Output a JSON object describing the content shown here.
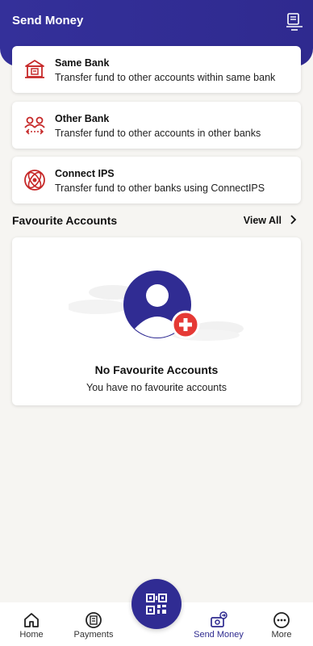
{
  "header": {
    "title": "Send Money"
  },
  "options": [
    {
      "title": "Same Bank",
      "desc": "Transfer fund to other accounts within same bank"
    },
    {
      "title": "Other Bank",
      "desc": "Transfer fund to other accounts in other banks"
    },
    {
      "title": "Connect IPS",
      "desc": "Transfer fund to other banks using ConnectIPS"
    }
  ],
  "favourites": {
    "title": "Favourite Accounts",
    "view_all": "View All",
    "empty_title": "No Favourite Accounts",
    "empty_subtitle": "You have no favourite accounts"
  },
  "nav": {
    "home": "Home",
    "payments": "Payments",
    "send_money": "Send Money",
    "more": "More"
  },
  "colors": {
    "brand": "#302c93",
    "accent": "#d32f2f"
  },
  "icons": [
    "transfer-history-icon",
    "bank-icon",
    "people-transfer-icon",
    "connect-ips-icon",
    "chevron-right-icon",
    "qr-scan-icon",
    "home-icon",
    "payments-icon",
    "send-money-icon",
    "more-icon"
  ]
}
